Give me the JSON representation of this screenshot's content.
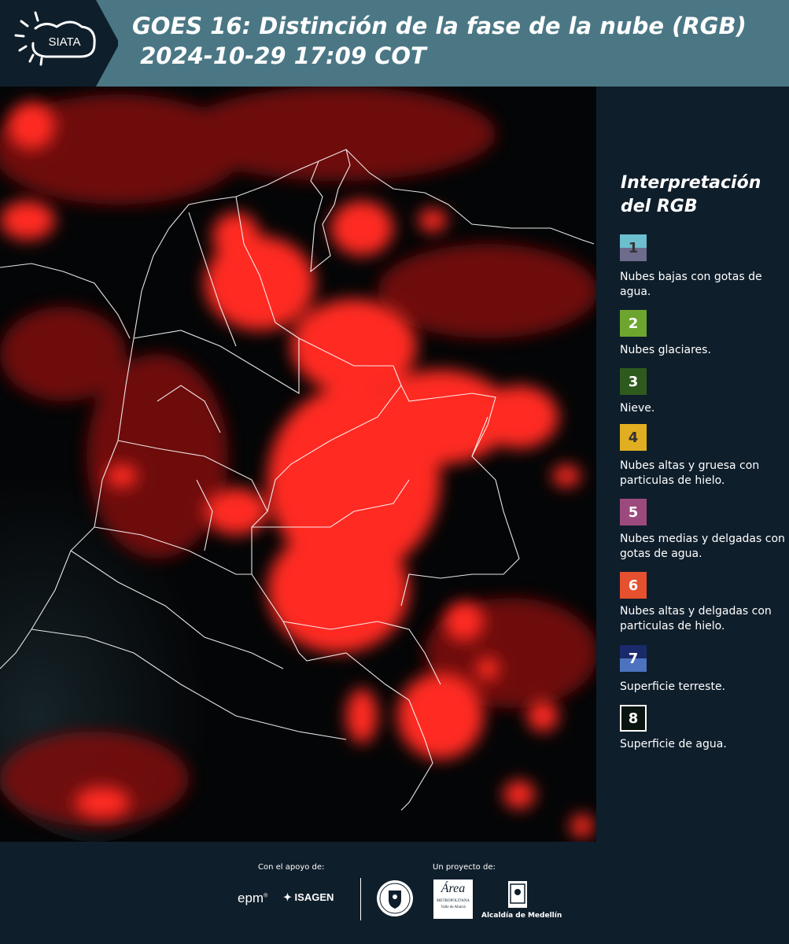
{
  "header": {
    "title_line1": "GOES 16: Distinción de la fase de la nube (RGB)",
    "title_line2": " 2024-10-29 17:09 COT",
    "logo_text": "SIATA",
    "logo_icon": "sun-cloud-icon"
  },
  "legend": {
    "title": "Interpretación del RGB",
    "items": [
      {
        "number": "1",
        "label": "Nubes bajas con gotas de agua.",
        "color_top": "#6bbfcf",
        "color_bottom": "#6e6c8c"
      },
      {
        "number": "2",
        "label": "Nubes glaciares.",
        "color_top": "#6ea52f",
        "color_bottom": "#6ea52f"
      },
      {
        "number": "3",
        "label": "Nieve.",
        "color_top": "#2f5a1e",
        "color_bottom": "#2f5a1e"
      },
      {
        "number": "4",
        "label": "Nubes altas y gruesa con particulas de hielo.",
        "color_top": "#e2ae21",
        "color_bottom": "#e2ae21"
      },
      {
        "number": "5",
        "label": "Nubes medias y delgadas con gotas de agua.",
        "color_top": "#9c4a7d",
        "color_bottom": "#9c4a7d"
      },
      {
        "number": "6",
        "label": "Nubes altas y delgadas con particulas de hielo.",
        "color_top": "#e5502f",
        "color_bottom": "#e5502f"
      },
      {
        "number": "7",
        "label": "Superficie terreste.",
        "color_top": "#1b2a6b",
        "color_bottom": "#4d73c0"
      },
      {
        "number": "8",
        "label": "Superficie de agua.",
        "color_top": "#0a1410",
        "color_bottom": "#0a1410"
      }
    ]
  },
  "footer": {
    "support_label": "Con el apoyo de:",
    "project_label": "Un proyecto de:",
    "sponsor_epm": "epm",
    "sponsor_isagen": "ISAGEN",
    "area_text": "Área",
    "area_sub": "METROPOLITANA",
    "area_sub2": "Valle de Aburrá",
    "alcaldia": "Alcaldía de Medellín"
  },
  "colors": {
    "header_bg": "#4b7785",
    "page_bg": "#0f1e2b",
    "cloud_red": "#ff2a22"
  }
}
